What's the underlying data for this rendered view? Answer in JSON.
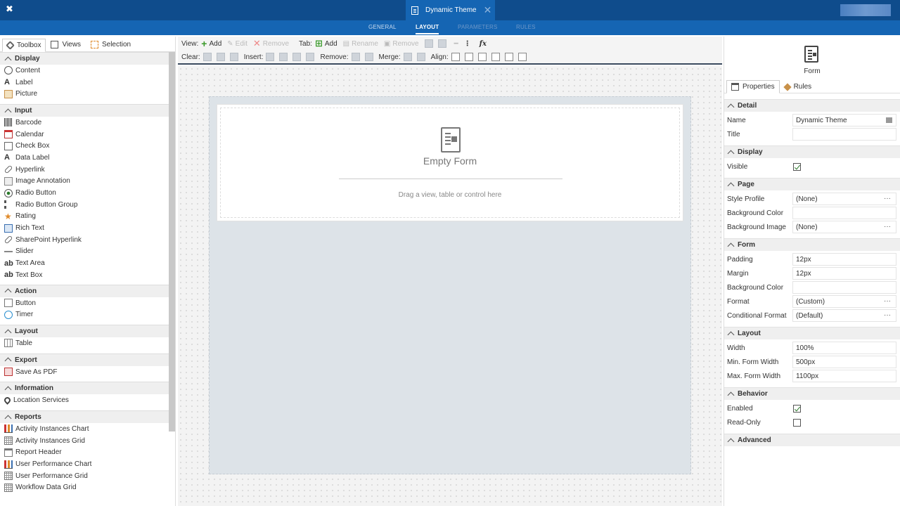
{
  "topbar": {
    "document_title": "Dynamic Theme",
    "close_glyph": "✕",
    "logo_glyph": "✖"
  },
  "nav": {
    "tabs": [
      "GENERAL",
      "LAYOUT",
      "PARAMETERS",
      "RULES"
    ],
    "active": "LAYOUT"
  },
  "left_tabs": [
    "Toolbox",
    "Views",
    "Selection"
  ],
  "toolbox": {
    "groups": [
      {
        "name": "Display",
        "items": [
          {
            "label": "Content",
            "icon": "content-icon"
          },
          {
            "label": "Label",
            "icon": "label-icon"
          },
          {
            "label": "Picture",
            "icon": "picture-icon"
          }
        ]
      },
      {
        "name": "Input",
        "items": [
          {
            "label": "Barcode",
            "icon": "barcode-icon"
          },
          {
            "label": "Calendar",
            "icon": "calendar-icon"
          },
          {
            "label": "Check Box",
            "icon": "checkbox-icon"
          },
          {
            "label": "Data Label",
            "icon": "data-label-icon"
          },
          {
            "label": "Hyperlink",
            "icon": "hyperlink-icon"
          },
          {
            "label": "Image Annotation",
            "icon": "image-annotation-icon"
          },
          {
            "label": "Radio Button",
            "icon": "radio-button-icon"
          },
          {
            "label": "Radio Button Group",
            "icon": "radio-button-group-icon"
          },
          {
            "label": "Rating",
            "icon": "rating-icon"
          },
          {
            "label": "Rich Text",
            "icon": "rich-text-icon"
          },
          {
            "label": "SharePoint Hyperlink",
            "icon": "sharepoint-hyperlink-icon"
          },
          {
            "label": "Slider",
            "icon": "slider-icon"
          },
          {
            "label": "Text Area",
            "icon": "text-area-icon"
          },
          {
            "label": "Text Box",
            "icon": "text-box-icon"
          }
        ]
      },
      {
        "name": "Action",
        "items": [
          {
            "label": "Button",
            "icon": "button-icon"
          },
          {
            "label": "Timer",
            "icon": "timer-icon"
          }
        ]
      },
      {
        "name": "Layout",
        "items": [
          {
            "label": "Table",
            "icon": "table-icon"
          }
        ]
      },
      {
        "name": "Export",
        "items": [
          {
            "label": "Save As PDF",
            "icon": "pdf-icon"
          }
        ]
      },
      {
        "name": "Information",
        "items": [
          {
            "label": "Location Services",
            "icon": "location-icon"
          }
        ]
      },
      {
        "name": "Reports",
        "items": [
          {
            "label": "Activity Instances Chart",
            "icon": "chart-icon"
          },
          {
            "label": "Activity Instances Grid",
            "icon": "grid-icon"
          },
          {
            "label": "Report Header",
            "icon": "report-header-icon"
          },
          {
            "label": "User Performance Chart",
            "icon": "chart-icon"
          },
          {
            "label": "User Performance Grid",
            "icon": "grid-icon"
          },
          {
            "label": "Workflow Data Grid",
            "icon": "grid-icon"
          }
        ]
      }
    ]
  },
  "toolbar": {
    "row1": {
      "view_label": "View:",
      "add": "Add",
      "edit": "Edit",
      "remove": "Remove",
      "tab_label": "Tab:",
      "tab_add": "Add",
      "tab_rename": "Rename",
      "tab_remove": "Remove",
      "fx": "fx"
    },
    "row2": {
      "clear_label": "Clear:",
      "insert_label": "Insert:",
      "remove_label": "Remove:",
      "merge_label": "Merge:",
      "align_label": "Align:"
    }
  },
  "canvas": {
    "empty_title": "Empty Form",
    "hint": "Drag a view, table or control here"
  },
  "properties": {
    "header_label": "Form",
    "tabs": [
      "Properties",
      "Rules"
    ],
    "sections": [
      {
        "name": "Detail",
        "rows": [
          {
            "label": "Name",
            "value": "Dynamic Theme",
            "type": "text-btn"
          },
          {
            "label": "Title",
            "value": "",
            "type": "text"
          }
        ]
      },
      {
        "name": "Display",
        "rows": [
          {
            "label": "Visible",
            "value": "",
            "type": "check-on"
          }
        ]
      },
      {
        "name": "Page",
        "rows": [
          {
            "label": "Style Profile",
            "value": "(None)",
            "type": "ellipsis"
          },
          {
            "label": "Background Color",
            "value": "",
            "type": "text"
          },
          {
            "label": "Background Image",
            "value": "(None)",
            "type": "ellipsis"
          }
        ]
      },
      {
        "name": "Form",
        "rows": [
          {
            "label": "Padding",
            "value": "12px",
            "type": "text"
          },
          {
            "label": "Margin",
            "value": "12px",
            "type": "text"
          },
          {
            "label": "Background Color",
            "value": "",
            "type": "text"
          },
          {
            "label": "Format",
            "value": "(Custom)",
            "type": "ellipsis"
          },
          {
            "label": "Conditional Format",
            "value": "(Default)",
            "type": "ellipsis"
          }
        ]
      },
      {
        "name": "Layout",
        "rows": [
          {
            "label": "Width",
            "value": "100%",
            "type": "text"
          },
          {
            "label": "Min. Form Width",
            "value": "500px",
            "type": "text"
          },
          {
            "label": "Max. Form Width",
            "value": "1100px",
            "type": "text"
          }
        ]
      },
      {
        "name": "Behavior",
        "rows": [
          {
            "label": "Enabled",
            "value": "",
            "type": "check-on"
          },
          {
            "label": "Read-Only",
            "value": "",
            "type": "check-off"
          }
        ]
      },
      {
        "name": "Advanced",
        "rows": []
      }
    ],
    "ellipsis_glyph": "···"
  },
  "colors": {
    "topbar": "#0f4c8c",
    "nav": "#1565b3",
    "accent": "#2a7a2a"
  }
}
